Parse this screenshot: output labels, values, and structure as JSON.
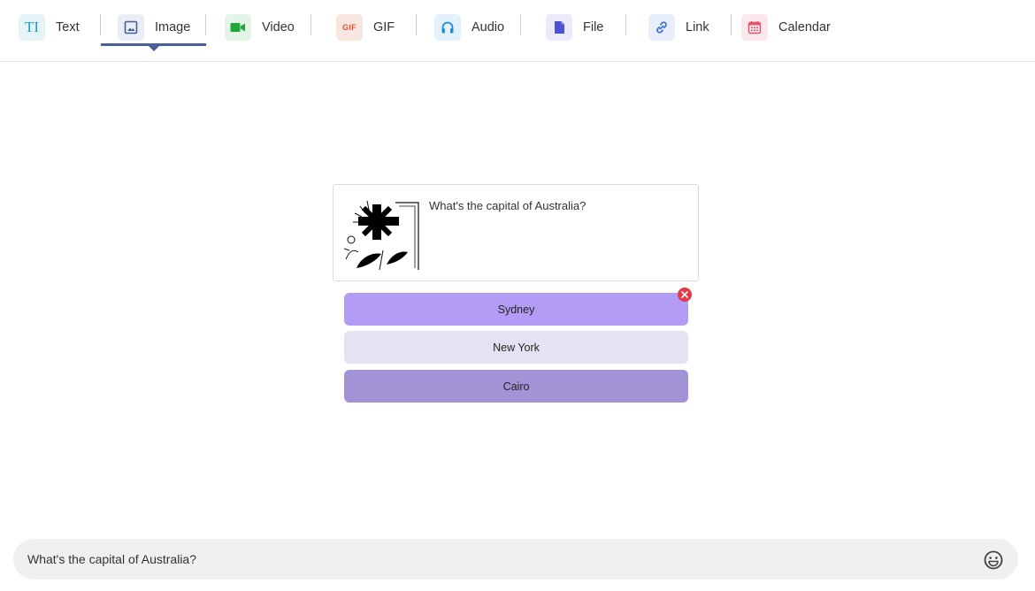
{
  "toolbar": {
    "tabs": [
      {
        "label": "Text",
        "icon": "text-icon",
        "icon_text": "TI",
        "bg": "#e6f4f8",
        "fg": "#1aa0c8"
      },
      {
        "label": "Image",
        "icon": "image-icon",
        "bg": "#e8edf6",
        "fg": "#47609a",
        "active": true
      },
      {
        "label": "Video",
        "icon": "video-camera-icon",
        "bg": "#e4f5e8",
        "fg": "#22a83a"
      },
      {
        "label": "GIF",
        "icon": "gif-icon",
        "icon_text": "GIF",
        "bg": "#f8e6e1",
        "fg": "#e0552f"
      },
      {
        "label": "Audio",
        "icon": "headphones-icon",
        "bg": "#e3f1fb",
        "fg": "#1e8ed8"
      },
      {
        "label": "File",
        "icon": "file-icon",
        "bg": "#eaeafb",
        "fg": "#4d52d6"
      },
      {
        "label": "Link",
        "icon": "link-icon",
        "bg": "#e8eefa",
        "fg": "#3a6fd1"
      },
      {
        "label": "Calendar",
        "icon": "calendar-icon",
        "bg": "#fbe8ec",
        "fg": "#e2546c"
      }
    ],
    "accent": "#47609a"
  },
  "card": {
    "question": "What's the capital of Australia?",
    "image": "illustration-thumbnail"
  },
  "options": [
    {
      "label": "Sydney",
      "color": "#b39cf5",
      "removable": true
    },
    {
      "label": "New York",
      "color": "#e7e2f3"
    },
    {
      "label": "Cairo",
      "color": "#a193d6"
    }
  ],
  "composer": {
    "value": "What's the capital of Australia?",
    "emoji_icon": "smiley-icon"
  }
}
